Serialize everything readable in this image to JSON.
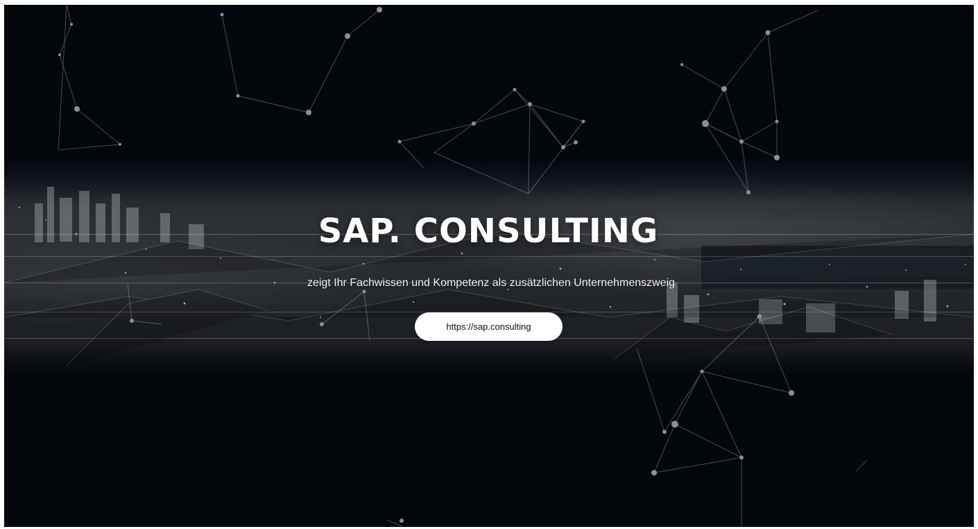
{
  "hero": {
    "title": "SAP. CONSULTING",
    "subtitle": "zeigt Ihr Fachwissen und Kompetenz als zusätzlichen Unternehmenszweig",
    "button_label": "https://sap.consulting"
  },
  "icons": {
    "background": "city-skyline-image",
    "overlay": "network-graph"
  },
  "colors": {
    "background": "#03060b",
    "text": "#ffffff",
    "button_bg": "#ffffff",
    "button_text": "#111111"
  }
}
